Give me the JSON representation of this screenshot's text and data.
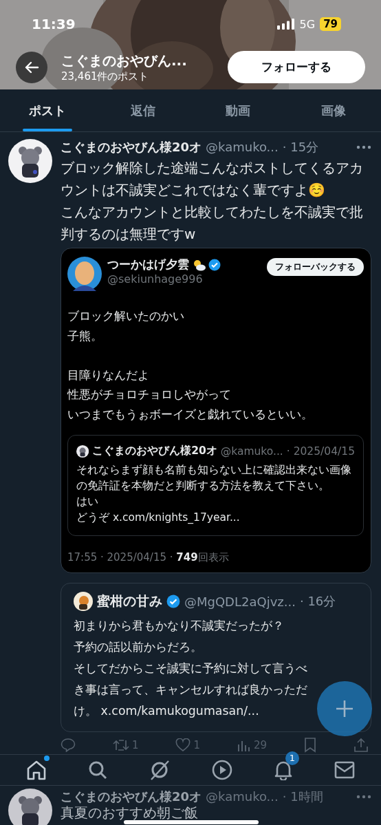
{
  "status_bar": {
    "time": "11:39",
    "network": "5G",
    "battery": "79"
  },
  "header": {
    "title": "こぐまのおやびん...",
    "post_count": "23,461件のポスト",
    "follow_button": "フォローする"
  },
  "tabs": [
    {
      "label": "ポスト",
      "selected": true
    },
    {
      "label": "返信",
      "selected": false
    },
    {
      "label": "動画",
      "selected": false
    },
    {
      "label": "画像",
      "selected": false
    }
  ],
  "post": {
    "name": "こぐまのおやびん様20オ",
    "handle": "@kamuko...",
    "time": "· 15分",
    "lines": [
      "ブロック解除した途端こんなポストしてくるアカウントは不誠実どこれではなく輩ですよ☺️",
      "こんなアカウントと比較してわたしを不誠実で批判するのは無理ですw"
    ],
    "quote": {
      "name": "つーかはげ夕雲",
      "verified": true,
      "handle": "@sekiunhage996",
      "follow_back_button": "フォローバックする",
      "paragraphs": [
        [
          "ブロック解いたのかい",
          "子熊。"
        ],
        [
          "目障りなんだよ",
          "性悪がチョロチョロしやがって",
          "いつまでもうぉボーイズと戯れているといい。"
        ]
      ],
      "nested_quote": {
        "name": "こぐまのおやびん様20オ",
        "handle": "@kamuko...",
        "date": "· 2025/04/15",
        "lines": [
          "それならまず顔も名前も知らない上に確認出来ない画像の免許証を本物だと判断する方法を教えて下さい。",
          "はい",
          "どうぞ x.com/knights_17year..."
        ]
      },
      "footer": "17:55 · 2025/04/15 · **749**回表示"
    },
    "reply_card": {
      "name": "蜜柑の甘み",
      "verified": true,
      "handle": "@MgQDL2aQjvz...",
      "time": "· 16分",
      "lines": [
        "初まりから君もかなり不誠実だったが？",
        "予約の話以前からだろ。",
        "そしてだからこそ誠実に予約に対して言うべき事は言って、キャンセルすれば良かっただけ。 x.com/kamukogumasan/..."
      ]
    },
    "actions": [
      {
        "kind": "reply"
      },
      {
        "kind": "repost",
        "count": "1"
      },
      {
        "kind": "like",
        "count": "1"
      },
      {
        "kind": "views",
        "count": "29"
      },
      {
        "kind": "bookmark"
      },
      {
        "kind": "share"
      }
    ]
  },
  "nav": [
    {
      "kind": "home",
      "dot": true
    },
    {
      "kind": "search"
    },
    {
      "kind": "grok"
    },
    {
      "kind": "video"
    },
    {
      "kind": "notifications",
      "badge": "1"
    },
    {
      "kind": "messages"
    }
  ],
  "next_post": {
    "name": "こぐまのおやびん様20オ",
    "handle": "@kamuko...",
    "time": "· 1時間",
    "body": "真夏のおすすめ朝ご飯"
  }
}
